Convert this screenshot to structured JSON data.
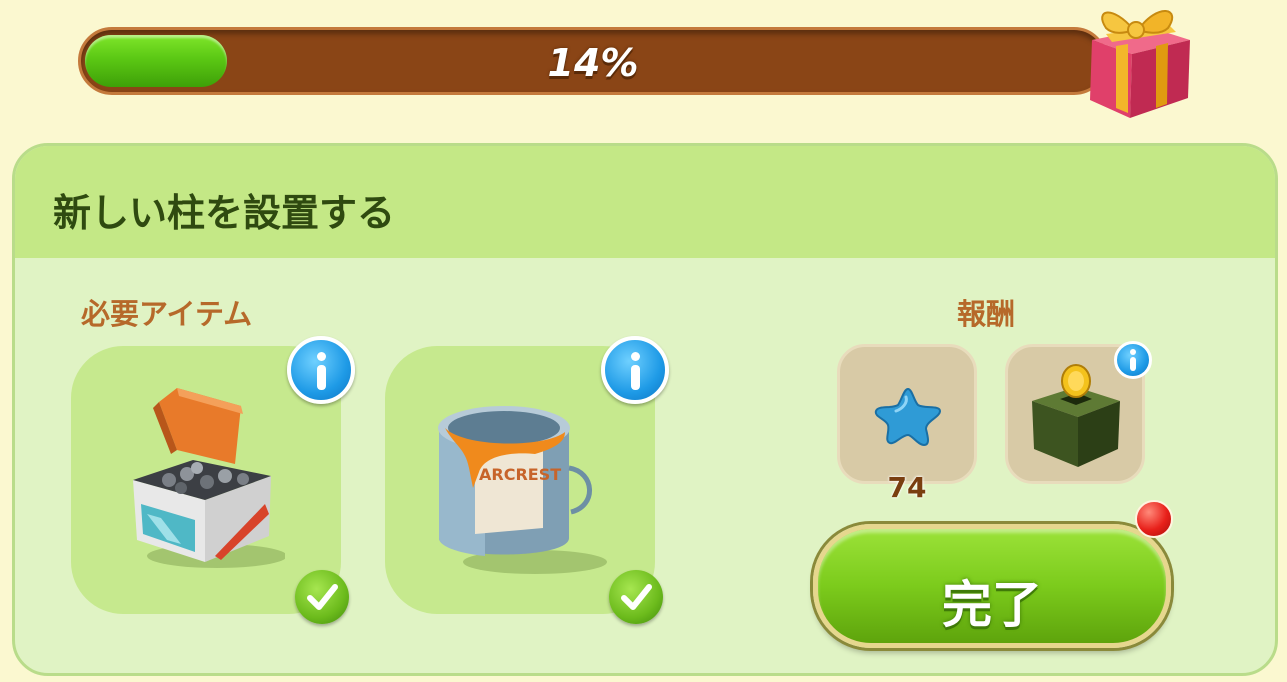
{
  "progress": {
    "percent_label": "14%",
    "fraction": 0.14
  },
  "quest": {
    "title": "新しい柱を設置する",
    "required_label": "必要アイテム",
    "reward_label": "報酬",
    "required_items": [
      {
        "icon": "screw-box-icon",
        "status": "complete"
      },
      {
        "icon": "paint-can-icon",
        "status": "complete",
        "can_label": "ARCREST"
      }
    ],
    "rewards": [
      {
        "icon": "blue-star-icon",
        "count": "74"
      },
      {
        "icon": "coin-chest-icon"
      }
    ],
    "complete_button": "完了"
  },
  "colors": {
    "progress_fill": "#5bc814",
    "progress_track": "#8a4516",
    "panel_header": "#c4e886",
    "panel_body": "#e0f3c4",
    "label_brown": "#b6692a",
    "button_green": "#7ccb1c"
  }
}
